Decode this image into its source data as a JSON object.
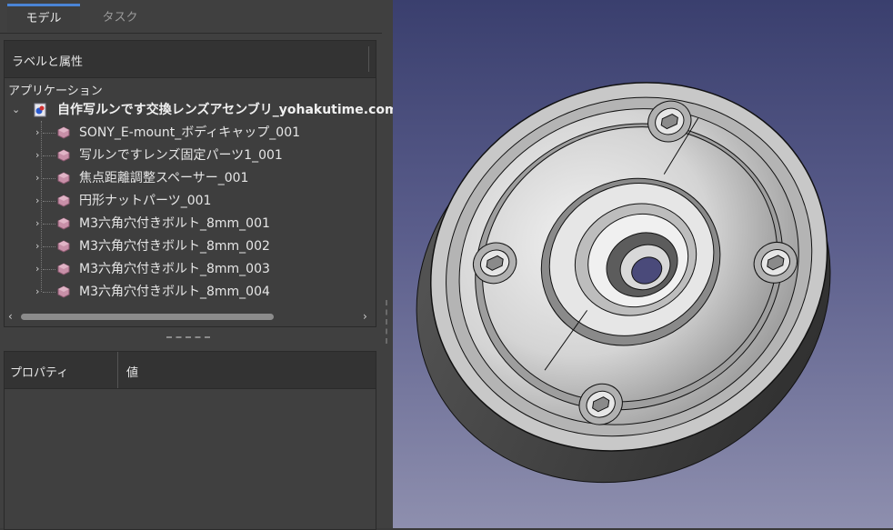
{
  "tabs": [
    {
      "label": "モデル",
      "active": true
    },
    {
      "label": "タスク",
      "active": false
    }
  ],
  "tree": {
    "header": "ラベルと属性",
    "root_label": "アプリケーション",
    "document": "自作写ルンです交換レンズアセンブリ_yohakutime.com",
    "items": [
      "SONY_E-mount_ボディキャップ_001",
      "写ルンですレンズ固定パーツ1_001",
      "焦点距離調整スペーサー_001",
      "円形ナットパーツ_001",
      "M3六角穴付きボルト_8mm_001",
      "M3六角穴付きボルト_8mm_002",
      "M3六角穴付きボルト_8mm_003",
      "M3六角穴付きボルト_8mm_004"
    ]
  },
  "properties": {
    "col_property": "プロパティ",
    "col_value": "値"
  },
  "colors": {
    "accent": "#4a84d6",
    "part_icon": "#c890a8",
    "panel_bg": "#404040",
    "viewport_top": "#3a3f6e",
    "viewport_bottom": "#8e8fae"
  },
  "icons": {
    "expander_open": "chevron-down-icon",
    "expander_closed": "chevron-right-icon",
    "document": "document-icon",
    "part": "part-icon"
  }
}
